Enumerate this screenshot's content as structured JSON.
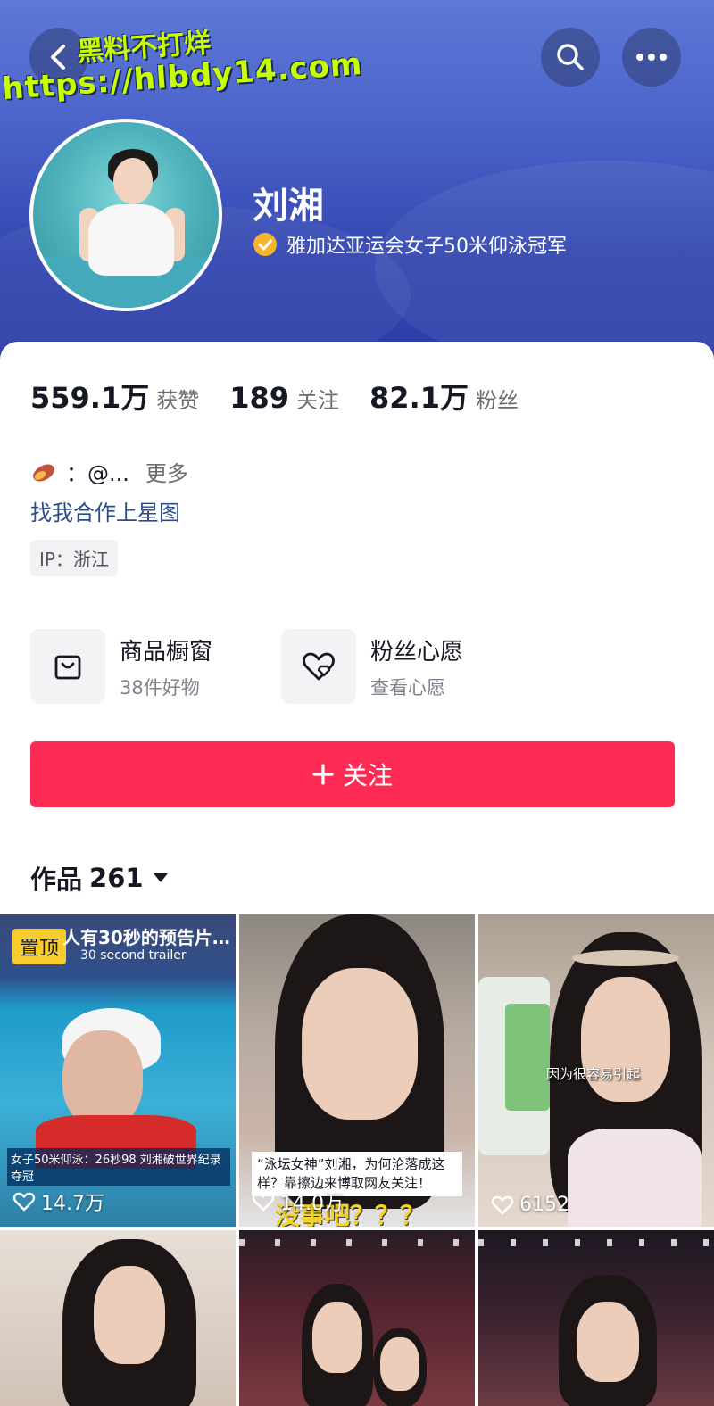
{
  "header": {
    "watermark_line1": "黑料不打烊",
    "watermark_line2": "https://hlbdy14.com"
  },
  "profile": {
    "name": "刘湘",
    "verification": "雅加达亚运会女子50米仰泳冠军"
  },
  "stats": [
    {
      "value": "559.1万",
      "label": "获赞"
    },
    {
      "value": "189",
      "label": "关注"
    },
    {
      "value": "82.1万",
      "label": "粉丝"
    }
  ],
  "bio": {
    "text": "：@...",
    "more": "更多",
    "collab_link": "找我合作上星图",
    "ip": "IP：浙江"
  },
  "features": {
    "shop": {
      "title": "商品橱窗",
      "subtitle": "38件好物",
      "icon": "shopping-bag-icon"
    },
    "wish": {
      "title": "粉丝心愿",
      "subtitle": "查看心愿",
      "icon": "heart-wish-icon"
    }
  },
  "follow_button": "关注",
  "works": {
    "label": "作品",
    "count": "261"
  },
  "videos": [
    {
      "pinned_label": "置顶",
      "title_top": "人有30秒的预告片…",
      "title_top_en": "30 second trailer",
      "caption": "女子50米仰泳：26秒98 刘湘破世界纪录夺冠",
      "likes": "14.7万"
    },
    {
      "caption": "“泳坛女神”刘湘，为何沦落成这样？靠擦边来博取网友关注！",
      "overlay": "没事吧？？？",
      "likes": "14.0万"
    },
    {
      "caption": "因为很容易引起",
      "likes": "6152"
    },
    {},
    {},
    {}
  ],
  "colors": {
    "accent": "#fe2c55",
    "link": "#2a4d8a",
    "banner": "#3346b0",
    "verify": "#f7b52b"
  }
}
